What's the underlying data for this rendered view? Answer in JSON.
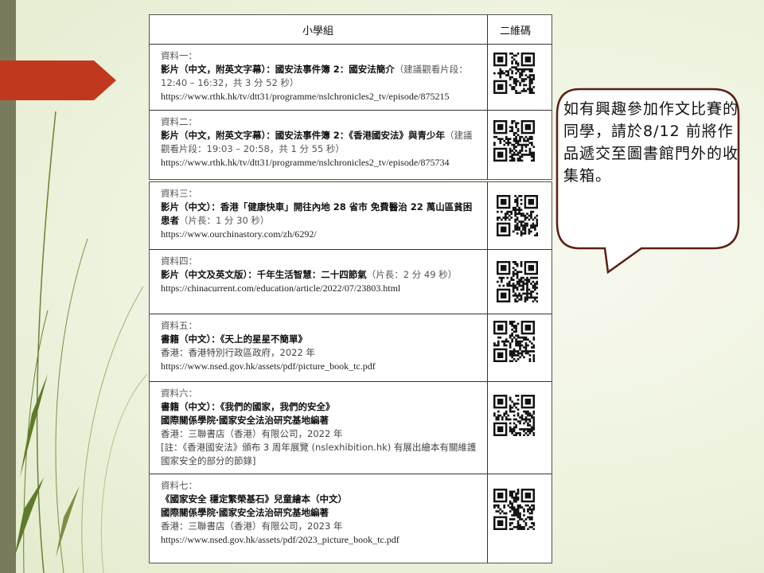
{
  "header": {
    "group": "小學組",
    "qr": "二維碼"
  },
  "items": [
    {
      "label": "資料一：",
      "title": "影片（中文，附英文字幕）：國安法事件簿 2：國安法簡介",
      "note": "（建議觀看片段：12:40 – 16:32，共 3 分 52 秒）",
      "url": "https://www.rthk.hk/tv/dtt31/programme/nslchronicles2_tv/episode/875215"
    },
    {
      "label": "資料二：",
      "title": "影片（中文，附英文字幕）：國安法事件簿 2：《香港國安法》與青少年",
      "note": "（建議觀看片段：19:03 – 20:58，共 1 分 55 秒）",
      "url": "https://www.rthk.hk/tv/dtt31/programme/nslchronicles2_tv/episode/875734"
    },
    {
      "label": "資料三：",
      "title": "影片（中文）：香港「健康快車」開往內地 28 省市 免費醫治 22 萬山區貧困患者",
      "note": "（片長：1 分 30 秒）",
      "url": "https://www.ourchinastory.com/zh/6292/"
    },
    {
      "label": "資料四：",
      "title": "影片（中文及英文版）：千年生活智慧：二十四節氣",
      "note": "（片長：2 分 49 秒）",
      "url": "https://chinacurrent.com/education/article/2022/07/23803.html"
    },
    {
      "label": "資料五：",
      "title": "書籍（中文）：《天上的星星不簡單》",
      "line2": "香港：香港特別行政區政府，2022 年",
      "url": "https://www.nsed.gov.hk/assets/pdf/picture_book_tc.pdf"
    },
    {
      "label": "資料六：",
      "title": "書籍（中文）：《我們的國家，我們的安全》",
      "title2": "國際關係學院‧國家安全法治研究基地編著",
      "line2": "香港：三聯書店（香港）有限公司，2022 年",
      "line3": "[註：《香港國安法》頒布 3 周年展覽 (nslexhibition.hk) 有展出繪本有關維護國家安全的部分的節錄]"
    },
    {
      "label": "資料七：",
      "title": "《國家安全 穩定繁榮基石》兒童繪本（中文）",
      "title2": "國際關係學院‧國家安全法治研究基地編著",
      "line2": "香港：三聯書店（香港）有限公司，2023 年",
      "url": "https://www.nsed.gov.hk/assets/pdf/2023_picture_book_tc.pdf"
    }
  ],
  "callout": {
    "text": "如有興趣參加作文比賽的同學，請於8/12 前將作品遞交至圖書館門外的收集箱。"
  },
  "icons": [
    "qr-code-icon",
    "speech-bubble",
    "arrow-shape"
  ],
  "colors": {
    "accent_red": "#c0391e",
    "side_bar": "#7a7b5c",
    "bubble_border": "#5c1f14"
  }
}
